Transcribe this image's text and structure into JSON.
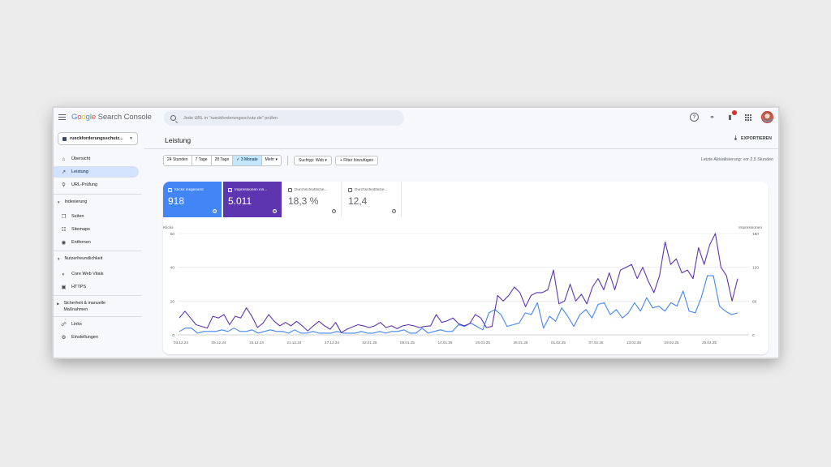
{
  "app": {
    "logo_google": [
      "G",
      "o",
      "o",
      "g",
      "l",
      "e"
    ],
    "logo_rest": "Search Console",
    "search_placeholder": "Jede URL in \"rueckforderungsschutz.de\" prüfen"
  },
  "sidebar": {
    "property": "rueckforderungsschutz...",
    "items": [
      {
        "label": "Übersicht",
        "icon": "home-icon"
      },
      {
        "label": "Leistung",
        "icon": "trending-up-icon",
        "active": true
      },
      {
        "label": "URL-Prüfung",
        "icon": "search-icon"
      }
    ],
    "sections": [
      {
        "label": "Indexierung",
        "items": [
          {
            "label": "Seiten",
            "icon": "pages-icon"
          },
          {
            "label": "Sitemaps",
            "icon": "sitemap-icon"
          },
          {
            "label": "Entfernen",
            "icon": "eye-off-icon"
          }
        ]
      },
      {
        "label": "Nutzerfreundlichkeit",
        "items": [
          {
            "label": "Core Web Vitals",
            "icon": "speed-icon"
          },
          {
            "label": "HTTPS",
            "icon": "lock-icon"
          }
        ]
      },
      {
        "label": "Sicherheit & manuelle Maßnahmen",
        "items": []
      }
    ],
    "bottom_items": [
      {
        "label": "Links",
        "icon": "link-icon"
      },
      {
        "label": "Einstellungen",
        "icon": "gear-icon"
      }
    ]
  },
  "main": {
    "title": "Leistung",
    "export_label": "EXPORTIEREN",
    "date_ranges": [
      "24 Stunden",
      "7 Tage",
      "28 Tage",
      "3 Monate",
      "Mehr"
    ],
    "selected_range": "3 Monate",
    "search_type": "Suchtyp: Web",
    "add_filter": "Filter hinzufügen",
    "last_update": "Letzte Aktualisierung: vor 2,5 Stunden",
    "metrics": [
      {
        "label": "Klicks insgesamt",
        "value": "918",
        "selected": true,
        "color": "#4285f4"
      },
      {
        "label": "Impressionen ins...",
        "value": "5.011",
        "selected": true,
        "color": "#5e35b1"
      },
      {
        "label": "Durchschnittliche...",
        "value": "18,3 %",
        "selected": false
      },
      {
        "label": "Durchschnittliche...",
        "value": "12,4",
        "selected": false
      }
    ]
  },
  "chart_data": {
    "type": "line",
    "left_axis_label": "Klicks",
    "right_axis_label": "Impressionen",
    "left_ticks": [
      "0",
      "20",
      "40",
      "60"
    ],
    "right_ticks": [
      "0",
      "60",
      "120",
      "180"
    ],
    "ylim_left": [
      0,
      60
    ],
    "ylim_right": [
      0,
      180
    ],
    "x_ticks": [
      "03.12.24",
      "09.12.24",
      "15.12.24",
      "21.12.24",
      "27.12.24",
      "02.01.25",
      "08.01.25",
      "14.01.25",
      "20.01.25",
      "26.01.25",
      "01.02.25",
      "07.02.25",
      "13.02.25",
      "19.02.25",
      "25.02.25"
    ],
    "series": [
      {
        "name": "Klicks",
        "axis": "left",
        "color": "#4285f4",
        "values": [
          2,
          4,
          4,
          1,
          2,
          2,
          2,
          3,
          2,
          4,
          2,
          2,
          3,
          1,
          2,
          3,
          2,
          2,
          1,
          3,
          1,
          1,
          2,
          1,
          1,
          1,
          2,
          1,
          1,
          1,
          2,
          1,
          1,
          2,
          1,
          2,
          2,
          3,
          1,
          1,
          4,
          1,
          2,
          3,
          2,
          2,
          6,
          5,
          7,
          5,
          3,
          13,
          15,
          12,
          5,
          6,
          7,
          13,
          12,
          19,
          4,
          11,
          8,
          16,
          11,
          5,
          12,
          15,
          10,
          18,
          19,
          12,
          15,
          10,
          13,
          19,
          14,
          22,
          16,
          17,
          14,
          19,
          17,
          26,
          14,
          13,
          22,
          35,
          35,
          17,
          14,
          12,
          13
        ]
      },
      {
        "name": "Impressionen",
        "axis": "right",
        "color": "#5e35b1",
        "values": [
          30,
          42,
          30,
          18,
          15,
          12,
          33,
          30,
          36,
          18,
          33,
          30,
          48,
          33,
          13,
          21,
          36,
          24,
          16,
          22,
          16,
          24,
          16,
          7,
          16,
          24,
          16,
          10,
          22,
          4,
          10,
          14,
          18,
          16,
          13,
          16,
          22,
          13,
          16,
          11,
          16,
          18,
          16,
          13,
          15,
          16,
          36,
          22,
          25,
          30,
          20,
          16,
          20,
          36,
          30,
          13,
          15,
          70,
          60,
          70,
          85,
          75,
          50,
          70,
          75,
          75,
          80,
          115,
          55,
          60,
          90,
          60,
          72,
          55,
          85,
          100,
          80,
          110,
          80,
          115,
          120,
          125,
          100,
          120,
          95,
          75,
          105,
          165,
          125,
          135,
          110,
          115,
          100,
          155,
          125,
          160,
          180,
          120,
          105,
          60,
          100
        ]
      }
    ]
  }
}
